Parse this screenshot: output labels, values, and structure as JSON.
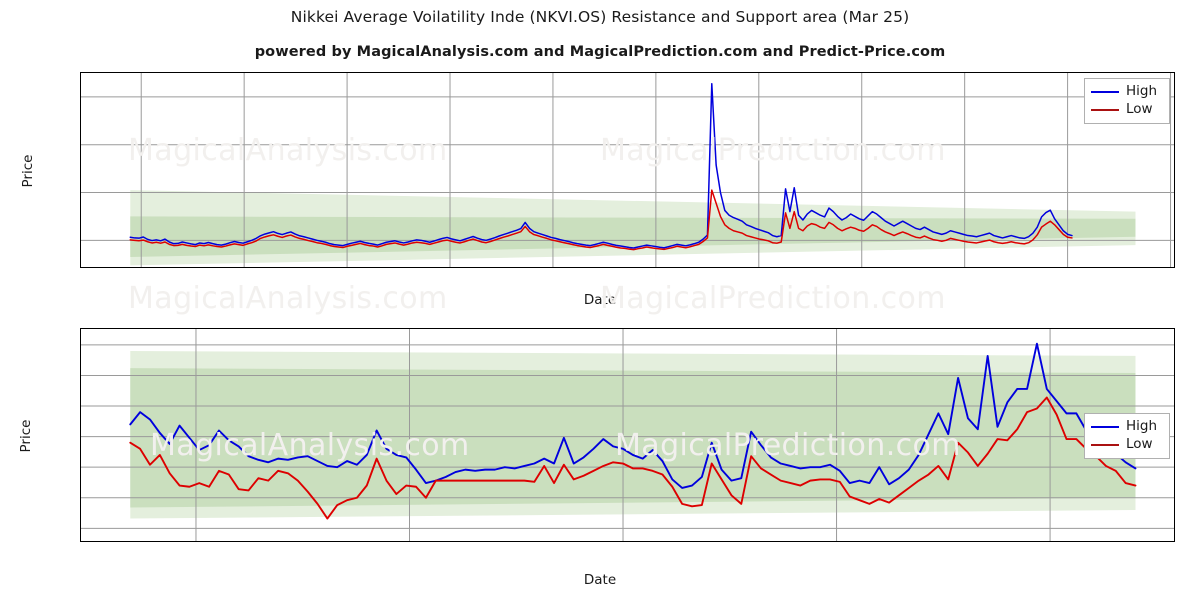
{
  "header": {
    "title": "Nikkei Average Voilatility Inde (NKVI.OS) Resistance and Support area (Mar 25)",
    "subtitle": "powered by MagicalAnalysis.com and MagicalPrediction.com and Predict-Price.com"
  },
  "watermarks": {
    "analysis": "MagicalAnalysis.com",
    "prediction": "MagicalPrediction.com"
  },
  "legend": {
    "high": "High",
    "low": "Low"
  },
  "colors": {
    "high": "#0000dd",
    "low": "#dd0000",
    "band_outer": "#e4efdd",
    "band_inner": "#cadfbe",
    "grid": "#9a9a9a",
    "axis": "#000000",
    "watermark": "#f2f0ee"
  },
  "chart_data": [
    {
      "type": "line",
      "id": "top-chart",
      "title": "Nikkei Average Voilatility Inde (NKVI.OS) Resistance and Support area (Mar 25)",
      "xlabel": "Date",
      "ylabel": "Price",
      "grid": true,
      "legend_position": "top-right",
      "ylim": [
        8,
        90
      ],
      "yticks": [
        20,
        40,
        60,
        80
      ],
      "xticks": [
        "2023-09",
        "2023-11",
        "2024-01",
        "2024-03",
        "2024-05",
        "2024-07",
        "2024-09",
        "2024-11",
        "2025-01",
        "2025-03",
        "2025-05"
      ],
      "xlim": [
        "2023-08-01",
        "2025-05-15"
      ],
      "x_index": [
        0,
        1,
        2,
        3,
        4,
        5,
        6,
        7,
        8,
        9,
        10,
        11,
        12,
        13,
        14,
        15,
        16,
        17,
        18,
        19,
        20,
        21,
        22,
        23,
        24,
        25,
        26,
        27,
        28,
        29,
        30,
        31,
        32,
        33,
        34,
        35,
        36,
        37,
        38,
        39,
        40,
        41,
        42,
        43,
        44,
        45,
        46,
        47,
        48,
        49,
        50,
        51,
        52,
        53,
        54,
        55,
        56,
        57,
        58,
        59,
        60,
        61,
        62,
        63,
        64,
        65,
        66,
        67,
        68,
        69,
        70,
        71,
        72,
        73,
        74,
        75,
        76,
        77,
        78,
        79,
        80,
        81,
        82,
        83,
        84,
        85,
        86,
        87,
        88,
        89,
        90,
        91,
        92,
        93,
        94,
        95,
        96,
        97,
        98,
        99,
        100,
        101,
        102,
        103,
        104,
        105,
        106,
        107,
        108,
        109,
        110,
        111,
        112,
        113,
        114,
        115,
        116,
        117,
        118,
        119,
        120,
        121,
        122,
        123,
        124,
        125,
        126,
        127,
        128,
        129,
        130,
        131,
        132,
        133,
        134,
        135,
        136,
        137,
        138,
        139,
        140,
        141,
        142,
        143,
        144,
        145,
        146,
        147,
        148,
        149,
        150,
        151,
        152,
        153,
        154,
        155,
        156,
        157,
        158,
        159,
        160,
        161,
        162,
        163,
        164,
        165,
        166,
        167,
        168,
        169,
        170,
        171,
        172,
        173,
        174,
        175,
        176,
        177,
        178,
        179,
        180,
        181,
        182,
        183,
        184,
        185,
        186,
        187,
        188,
        189,
        190,
        191,
        192,
        193,
        194,
        195,
        196,
        197,
        198,
        199,
        200,
        201,
        202,
        203,
        204,
        205,
        206,
        207,
        208,
        209
      ],
      "series": [
        {
          "name": "High",
          "color": "#0000dd",
          "values": [
            21.3,
            21.0,
            20.9,
            21.4,
            20.4,
            19.9,
            20.2,
            19.8,
            20.5,
            19.3,
            18.6,
            18.7,
            19.3,
            18.9,
            18.5,
            18.2,
            18.9,
            18.6,
            19.1,
            18.6,
            18.2,
            18.0,
            18.4,
            19.0,
            19.5,
            19.1,
            18.8,
            19.4,
            20.0,
            20.8,
            21.9,
            22.6,
            23.1,
            23.6,
            22.9,
            22.4,
            23.0,
            23.5,
            22.6,
            21.9,
            21.5,
            21.0,
            20.5,
            20.0,
            19.6,
            19.2,
            18.6,
            18.2,
            18.0,
            17.8,
            18.3,
            18.8,
            19.2,
            19.6,
            19.1,
            18.7,
            18.4,
            18.0,
            18.6,
            19.2,
            19.5,
            19.8,
            19.3,
            18.9,
            19.3,
            19.8,
            20.2,
            20.0,
            19.6,
            19.2,
            19.7,
            20.3,
            20.8,
            21.2,
            20.6,
            20.2,
            19.8,
            20.4,
            21.0,
            21.6,
            20.9,
            20.3,
            20.0,
            20.5,
            21.1,
            21.8,
            22.4,
            23.0,
            23.6,
            24.2,
            24.9,
            27.5,
            25.0,
            23.6,
            23.0,
            22.4,
            21.8,
            21.2,
            20.8,
            20.3,
            19.9,
            19.5,
            19.0,
            18.6,
            18.3,
            18.0,
            17.8,
            18.2,
            18.7,
            19.2,
            18.8,
            18.3,
            17.9,
            17.6,
            17.3,
            17.0,
            16.8,
            17.2,
            17.6,
            18.0,
            17.7,
            17.4,
            17.1,
            16.9,
            17.3,
            17.8,
            18.3,
            18.0,
            17.7,
            18.1,
            18.6,
            19.2,
            20.5,
            22.2,
            85.5,
            51.5,
            40.0,
            32.5,
            30.5,
            29.5,
            28.8,
            28.0,
            26.5,
            25.8,
            25.0,
            24.4,
            23.8,
            23.2,
            22.0,
            21.5,
            22.0,
            41.5,
            32.0,
            42.0,
            30.5,
            28.5,
            31.0,
            32.5,
            31.5,
            30.5,
            29.8,
            33.5,
            32.0,
            30.0,
            28.5,
            29.5,
            31.0,
            30.0,
            29.0,
            28.4,
            30.2,
            32.0,
            31.0,
            29.5,
            28.0,
            27.0,
            26.0,
            27.0,
            28.0,
            27.0,
            26.0,
            25.0,
            24.5,
            25.5,
            24.5,
            23.5,
            23.0,
            22.5,
            23.0,
            24.0,
            23.5,
            23.0,
            22.5,
            22.0,
            21.8,
            21.5,
            22.0,
            22.5,
            23.0,
            22.0,
            21.5,
            21.0,
            21.5,
            22.0,
            21.5,
            21.0,
            20.8,
            21.5,
            23.0,
            25.5,
            29.8,
            31.6,
            32.6,
            29.0,
            26.5,
            24.0,
            22.5,
            22.0
          ]
        },
        {
          "name": "Low",
          "color": "#dd0000",
          "values": [
            20.2,
            20.0,
            19.8,
            20.1,
            19.4,
            18.9,
            19.2,
            18.8,
            19.3,
            18.3,
            17.8,
            17.9,
            18.3,
            17.9,
            17.6,
            17.4,
            18.0,
            17.7,
            18.1,
            17.7,
            17.4,
            17.2,
            17.6,
            18.1,
            18.5,
            18.2,
            17.9,
            18.5,
            19.0,
            19.7,
            20.8,
            21.4,
            21.9,
            22.3,
            21.7,
            21.2,
            21.8,
            22.2,
            21.4,
            20.8,
            20.4,
            19.9,
            19.5,
            19.0,
            18.7,
            18.3,
            17.8,
            17.4,
            17.2,
            17.0,
            17.5,
            17.9,
            18.3,
            18.7,
            18.2,
            17.8,
            17.6,
            17.2,
            17.7,
            18.3,
            18.6,
            18.9,
            18.4,
            18.0,
            18.4,
            18.9,
            19.2,
            19.0,
            18.7,
            18.3,
            18.8,
            19.3,
            19.8,
            20.1,
            19.6,
            19.2,
            18.9,
            19.4,
            20.0,
            20.5,
            19.9,
            19.3,
            19.0,
            19.5,
            20.1,
            20.7,
            21.3,
            21.8,
            22.4,
            23.0,
            23.6,
            25.8,
            23.6,
            22.4,
            21.9,
            21.3,
            20.8,
            20.2,
            19.8,
            19.4,
            19.0,
            18.6,
            18.2,
            17.8,
            17.5,
            17.2,
            17.0,
            17.4,
            17.8,
            18.3,
            17.9,
            17.5,
            17.1,
            16.8,
            16.6,
            16.3,
            16.1,
            16.5,
            16.8,
            17.2,
            16.9,
            16.6,
            16.4,
            16.2,
            16.6,
            17.0,
            17.5,
            17.2,
            16.9,
            17.3,
            17.8,
            18.3,
            19.5,
            21.0,
            41.0,
            35.5,
            30.0,
            26.5,
            25.0,
            24.0,
            23.5,
            23.0,
            22.0,
            21.5,
            21.0,
            20.5,
            20.2,
            19.8,
            19.0,
            18.8,
            19.3,
            31.5,
            25.0,
            32.0,
            25.0,
            24.0,
            26.0,
            27.0,
            26.5,
            25.5,
            25.0,
            27.5,
            26.5,
            25.0,
            24.0,
            24.8,
            25.5,
            25.0,
            24.2,
            23.8,
            25.0,
            26.5,
            25.8,
            24.5,
            23.5,
            22.8,
            22.0,
            22.8,
            23.5,
            22.8,
            22.0,
            21.3,
            21.0,
            21.8,
            21.0,
            20.3,
            20.0,
            19.6,
            20.0,
            20.8,
            20.4,
            20.0,
            19.6,
            19.3,
            19.1,
            18.9,
            19.3,
            19.7,
            20.1,
            19.4,
            19.0,
            18.7,
            19.0,
            19.4,
            19.0,
            18.7,
            18.5,
            19.0,
            20.2,
            22.3,
            25.5,
            26.8,
            28.0,
            26.5,
            24.5,
            22.5,
            21.3,
            21.0
          ]
        }
      ],
      "bands": {
        "description": "Resistance and support area shading",
        "outer": {
          "color": "#e4efdd",
          "x_start_frac": 0.045,
          "x_end_frac": 0.963,
          "left_top": 41.0,
          "left_bottom": 9.5,
          "right_top": 32.0,
          "right_bottom": 18.0
        },
        "inner": {
          "color": "#cadfbe",
          "x_start_frac": 0.045,
          "x_end_frac": 0.963,
          "left_top": 30.0,
          "left_bottom": 13.0,
          "right_top": 29.0,
          "right_bottom": 21.5
        }
      }
    },
    {
      "type": "line",
      "id": "bottom-chart",
      "title": "",
      "xlabel": "Date",
      "ylabel": "Price",
      "grid": true,
      "legend_position": "right",
      "ylim": [
        16.3,
        33.8
      ],
      "yticks": [
        17.5,
        20.0,
        22.5,
        25.0,
        27.5,
        30.0,
        32.5
      ],
      "xticks": [
        "2024-12",
        "2025-01",
        "2025-02",
        "2025-03",
        "2025-04"
      ],
      "xlim": [
        "2024-11-13",
        "2025-04-22"
      ],
      "x_index": [
        0,
        1,
        2,
        3,
        4,
        5,
        6,
        7,
        8,
        9,
        10,
        11,
        12,
        13,
        14,
        15,
        16,
        17,
        18,
        19,
        20,
        21,
        22,
        23,
        24,
        25,
        26,
        27,
        28,
        29,
        30,
        31,
        32,
        33,
        34,
        35,
        36,
        37,
        38,
        39,
        40,
        41,
        42,
        43,
        44,
        45,
        46,
        47,
        48,
        49,
        50,
        51,
        52,
        53,
        54,
        55,
        56,
        57,
        58,
        59,
        60,
        61,
        62,
        63,
        64,
        65,
        66,
        67,
        68,
        69,
        70,
        71,
        72,
        73,
        74,
        75,
        76,
        77,
        78,
        79,
        80,
        81,
        82,
        83,
        84,
        85,
        86,
        87,
        88,
        89,
        90,
        91,
        92,
        93,
        94,
        95,
        96,
        97,
        98,
        99,
        100,
        101,
        102
      ],
      "series": [
        {
          "name": "High",
          "color": "#0000dd",
          "values": [
            26.0,
            27.0,
            26.4,
            25.3,
            24.4,
            25.9,
            24.9,
            23.9,
            24.3,
            25.5,
            24.7,
            24.2,
            23.4,
            23.1,
            22.9,
            23.2,
            23.1,
            23.3,
            23.4,
            23.0,
            22.6,
            22.5,
            23.0,
            22.7,
            23.5,
            25.5,
            24.0,
            23.5,
            23.3,
            22.3,
            21.2,
            21.4,
            21.7,
            22.1,
            22.3,
            22.2,
            22.3,
            22.3,
            22.5,
            22.4,
            22.6,
            22.8,
            23.2,
            22.8,
            24.9,
            22.8,
            23.3,
            24.0,
            24.8,
            24.2,
            24.0,
            23.5,
            23.2,
            23.9,
            23.0,
            21.5,
            20.8,
            21.0,
            21.7,
            24.5,
            22.3,
            21.4,
            21.6,
            25.4,
            24.3,
            23.3,
            22.8,
            22.6,
            22.4,
            22.5,
            22.5,
            22.7,
            22.2,
            21.2,
            21.4,
            21.2,
            22.5,
            21.1,
            21.6,
            22.3,
            23.5,
            25.2,
            26.9,
            25.2,
            29.8,
            26.5,
            25.6,
            31.6,
            25.8,
            27.8,
            28.9,
            28.9,
            32.6,
            28.9,
            27.9,
            26.9,
            26.9,
            25.5,
            24.6,
            23.7,
            23.6,
            22.9,
            22.4
          ]
        },
        {
          "name": "Low",
          "color": "#dd0000",
          "values": [
            24.5,
            24.0,
            22.7,
            23.5,
            22.0,
            21.0,
            20.9,
            21.2,
            20.9,
            22.2,
            21.9,
            20.7,
            20.6,
            21.6,
            21.4,
            22.2,
            22.0,
            21.4,
            20.5,
            19.5,
            18.3,
            19.4,
            19.8,
            20.0,
            21.0,
            23.2,
            21.4,
            20.3,
            21.0,
            20.9,
            20.0,
            21.4,
            21.4,
            21.4,
            21.4,
            21.4,
            21.4,
            21.4,
            21.4,
            21.4,
            21.4,
            21.3,
            22.6,
            21.2,
            22.7,
            21.5,
            21.8,
            22.2,
            22.6,
            22.9,
            22.8,
            22.4,
            22.4,
            22.2,
            21.9,
            20.9,
            19.5,
            19.3,
            19.4,
            22.8,
            21.5,
            20.2,
            19.5,
            23.4,
            22.4,
            21.9,
            21.4,
            21.2,
            21.0,
            21.4,
            21.5,
            21.5,
            21.3,
            20.1,
            19.8,
            19.5,
            19.9,
            19.6,
            20.2,
            20.8,
            21.4,
            21.9,
            22.6,
            21.5,
            24.5,
            23.7,
            22.6,
            23.6,
            24.8,
            24.7,
            25.6,
            27.0,
            27.3,
            28.2,
            26.8,
            24.8,
            24.8,
            24.0,
            23.4,
            22.6,
            22.2,
            21.2,
            21.0
          ]
        }
      ],
      "bands": {
        "description": "Resistance and support area shading",
        "outer": {
          "color": "#e4efdd",
          "x_start_frac": 0.045,
          "x_end_frac": 0.963,
          "left_top": 32.0,
          "left_bottom": 18.3,
          "right_top": 31.6,
          "right_bottom": 19.0
        },
        "inner": {
          "color": "#cadfbe",
          "x_start_frac": 0.045,
          "x_end_frac": 0.963,
          "left_top": 30.6,
          "left_bottom": 19.2,
          "right_top": 30.2,
          "right_bottom": 20.0
        }
      }
    }
  ]
}
